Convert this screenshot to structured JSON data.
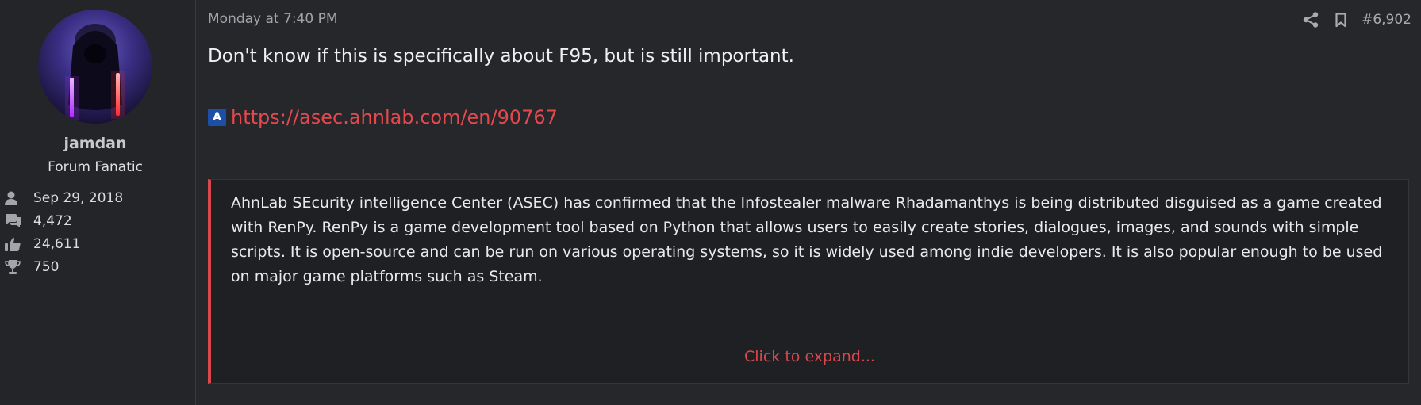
{
  "user": {
    "name": "jamdan",
    "title": "Forum Fanatic",
    "stats": [
      {
        "icon": "user-icon",
        "value": "Sep 29, 2018"
      },
      {
        "icon": "messages-icon",
        "value": "4,472"
      },
      {
        "icon": "thumbs-up-icon",
        "value": "24,611"
      },
      {
        "icon": "trophy-icon",
        "value": "750"
      }
    ]
  },
  "post": {
    "date": "Monday at 7:40 PM",
    "number": "#6,902",
    "text": "Don't know if this is specifically about F95, but is still important.",
    "link": {
      "favicon_letter": "A",
      "url": "https://asec.ahnlab.com/en/90767"
    },
    "quote": {
      "text": "AhnLab SEcurity intelligence Center (ASEC) has confirmed that the Infostealer malware Rhadamanthys is being distributed disguised as a game created with RenPy. RenPy is a game development tool based on Python that allows users to easily create stories, dialogues, images, and sounds with simple scripts. It is open-source and can be run on various operating systems, so it is widely used among indie developers. It is also popular enough to be used on major game platforms such as Steam.",
      "expand_label": "Click to expand..."
    }
  },
  "colors": {
    "accent": "#d8484c",
    "link": "#e5484d",
    "background": "#26272b",
    "quote_background": "#1f2024"
  }
}
